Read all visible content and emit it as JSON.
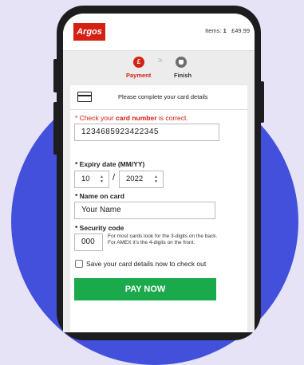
{
  "header": {
    "logo_text": "Argos",
    "items_label": "Items:",
    "items_count": "1",
    "total": "£49.99"
  },
  "steps": [
    {
      "label": "Payment",
      "icon": "£",
      "state": "active"
    },
    {
      "label": "Finish",
      "icon": "",
      "state": "inactive"
    }
  ],
  "card_section": {
    "title": "Please complete your card details",
    "error_prefix": "* Check your ",
    "error_bold": "card number",
    "error_suffix": " is correct.",
    "card_number": "1234685923422345",
    "expiry_label": "* Expiry date (MM/YY)",
    "expiry_month": "10",
    "expiry_separator": "/",
    "expiry_year": "2022",
    "name_label": "* Name on card",
    "name_placeholder": "Your Name",
    "cvv_label": "* Security code",
    "cvv_value": "000",
    "cvv_help": "For most cards look for the 3-digits on the back. For AMEX it's the 4-digits on the front.",
    "save_label": "Save your card details now to check out",
    "pay_button": "PAY NOW"
  },
  "colors": {
    "brand_red": "#d42114",
    "pay_green": "#1aaa4c",
    "circle_blue": "#4250dc",
    "background": "#e6e3f7"
  }
}
